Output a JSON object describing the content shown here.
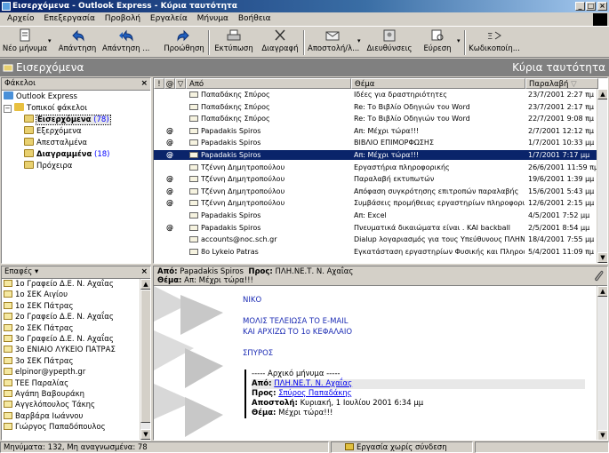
{
  "window": {
    "title": "Εισερχόμενα - Outlook Express - Κύρια ταυτότητα"
  },
  "menu": [
    "Αρχείο",
    "Επεξεργασία",
    "Προβολή",
    "Εργαλεία",
    "Μήνυμα",
    "Βοήθεια"
  ],
  "toolbar": [
    {
      "label": "Νέο μήνυμα",
      "icon": "new-mail-icon"
    },
    {
      "label": "Απάντηση",
      "icon": "reply-icon"
    },
    {
      "label": "Απάντηση ...",
      "icon": "reply-all-icon"
    },
    {
      "label": "Προώθηση",
      "icon": "forward-icon"
    },
    {
      "label": "Εκτύπωση",
      "icon": "print-icon"
    },
    {
      "label": "Διαγραφή",
      "icon": "delete-icon"
    },
    {
      "label": "Αποστολή/λ...",
      "icon": "send-receive-icon"
    },
    {
      "label": "Διευθύνσεις",
      "icon": "addresses-icon"
    },
    {
      "label": "Εύρεση",
      "icon": "find-icon"
    },
    {
      "label": "Κωδικοποίη...",
      "icon": "encoding-icon"
    }
  ],
  "banner": {
    "folder": "Εισερχόμενα",
    "identity": "Κύρια ταυτότητα"
  },
  "folders": {
    "header": "Φάκελοι",
    "items": [
      {
        "label": "Outlook Express",
        "count": ""
      },
      {
        "label": "Τοπικοί φάκελοι",
        "count": ""
      },
      {
        "label": "Εισερχόμενα",
        "count": "(78)"
      },
      {
        "label": "Εξερχόμενα",
        "count": ""
      },
      {
        "label": "Απεσταλμένα",
        "count": ""
      },
      {
        "label": "Διαγραμμένα",
        "count": "(18)"
      },
      {
        "label": "Πρόχειρα",
        "count": ""
      }
    ]
  },
  "messages": {
    "columns": {
      "from": "Από",
      "subject": "Θέμα",
      "received": "Παραλαβή"
    },
    "rows": [
      {
        "from": "Παπαδάκης Σπύρος",
        "subject": "Ιδέες για δραστηριότητες",
        "date": "23/7/2001 2:27 πμ",
        "attach": ""
      },
      {
        "from": "Παπαδάκης Σπύρος",
        "subject": "Re: Το Βιβλίο Οδηγιών του Word",
        "date": "23/7/2001 2:17 πμ",
        "attach": ""
      },
      {
        "from": "Παπαδάκης Σπύρος",
        "subject": "Re: Το Βιβλίο Οδηγιών του Word",
        "date": "22/7/2001 9:08 πμ",
        "attach": ""
      },
      {
        "from": "Papadakis Spiros",
        "subject": "Απ: Μέχρι τώρα!!!",
        "date": "2/7/2001 12:12 πμ",
        "attach": "@"
      },
      {
        "from": "Papadakis Spiros",
        "subject": "ΒΙΒΛΙΟ ΕΠΙΜΟΡΦΩΣΗΣ",
        "date": "1/7/2001 10:33 μμ",
        "attach": "@"
      },
      {
        "from": "Papadakis Spiros",
        "subject": "Απ: Μέχρι τώρα!!!",
        "date": "1/7/2001 7:17 μμ",
        "attach": "@"
      },
      {
        "from": "Τζέννη Δημητροπούλου",
        "subject": "Εργαστήρια πληροφορικής",
        "date": "26/6/2001 11:59 πμ",
        "attach": ""
      },
      {
        "from": "Τζέννη Δημητροπούλου",
        "subject": "Παραλαβή εκτυπωτών",
        "date": "19/6/2001 1:39 μμ",
        "attach": "@"
      },
      {
        "from": "Τζέννη Δημητροπούλου",
        "subject": "Απόφαση συγκρότησης επιτροπών παραλαβής",
        "date": "15/6/2001 5:43 μμ",
        "attach": "@"
      },
      {
        "from": "Τζέννη Δημητροπούλου",
        "subject": "Συμβάσεις προμήθειας εργαστηρίων πληροφορικής",
        "date": "12/6/2001 2:15 μμ",
        "attach": "@"
      },
      {
        "from": "Papadakis Spiros",
        "subject": "Απ: Excel",
        "date": "4/5/2001 7:52 μμ",
        "attach": ""
      },
      {
        "from": "Papadakis Spiros",
        "subject": "Πνευματικά δικαιώματα είναι . ΚΑΙ backball",
        "date": "2/5/2001 8:54 μμ",
        "attach": "@"
      },
      {
        "from": "accounts@noc.sch.gr",
        "subject": "Dialup λογαριασμός για τους Υπεύθυνους ΠΛΗΝΕΤ Β",
        "date": "18/4/2001 7:55 μμ",
        "attach": ""
      },
      {
        "from": "8ο Lykeio Patras",
        "subject": "Εγκατάσταση εργαστηρίων Φυσικής και Πληροφο...",
        "date": "5/4/2001 11:09 πμ",
        "attach": ""
      }
    ]
  },
  "contacts": {
    "header": "Επαφές ▾",
    "items": [
      "1ο Γραφείο Δ.Ε. Ν. Αχαΐας",
      "1ο ΣΕΚ Αιγίου",
      "1ο ΣΕΚ Πάτρας",
      "2ο Γραφείο Δ.Ε. Ν. Αχαΐας",
      "2ο ΣΕΚ Πάτρας",
      "3ο Γραφείο Δ.Ε. Ν. Αχαΐας",
      "3ο ΕΝΙΑΙΟ ΛΥΚΕΙΟ ΠΑΤΡΑΣ",
      "3ο ΣΕΚ Πάτρας",
      "elpinor@ypepth.gr",
      "ΤΕΕ Παραλίας",
      "Αγάπη Βαβουράκη",
      "Αγγελόπουλος Τάκης",
      "Βαρβάρα Ιωάννου",
      "Γιώργος Παπαδόπουλος"
    ]
  },
  "preview": {
    "from_label": "Από:",
    "from": "Papadakis Spiros",
    "to_label": "Προς:",
    "to": "ΠΛΗ.ΝΕ.Τ. Ν. Αχαΐας",
    "subject_label": "Θέμα:",
    "subject": "Απ: Μέχρι τώρα!!!",
    "body": [
      "ΝΙΚΟ",
      "ΜΟΛΙΣ ΤΕΛΕΙΩΣΑ ΤΟ E-MAIL",
      "ΚΑΙ ΑΡΧΙΖΩ ΤΟ 1ο ΚΕΦΑΛΑΙΟ",
      "ΣΠΥΡΟΣ"
    ],
    "quote_header": "----- Αρχικό μήνυμα -----",
    "q_from_label": "Από:",
    "q_from": "ΠΛΗ.ΝΕ.Τ. Ν. Αχαΐας",
    "q_to_label": "Προς:",
    "q_to": "Σπύρος Παπαδάκης",
    "q_sent_label": "Αποστολή:",
    "q_sent": "Κυριακή, 1 Ιουλίου 2001 6:34 μμ",
    "q_subject_label": "Θέμα:",
    "q_subject": "Μέχρι τώρα!!!"
  },
  "status": {
    "left": "Μηνύματα: 132, Μη αναγνωσμένα: 78",
    "mid": "Εργασία χωρίς σύνδεση"
  }
}
